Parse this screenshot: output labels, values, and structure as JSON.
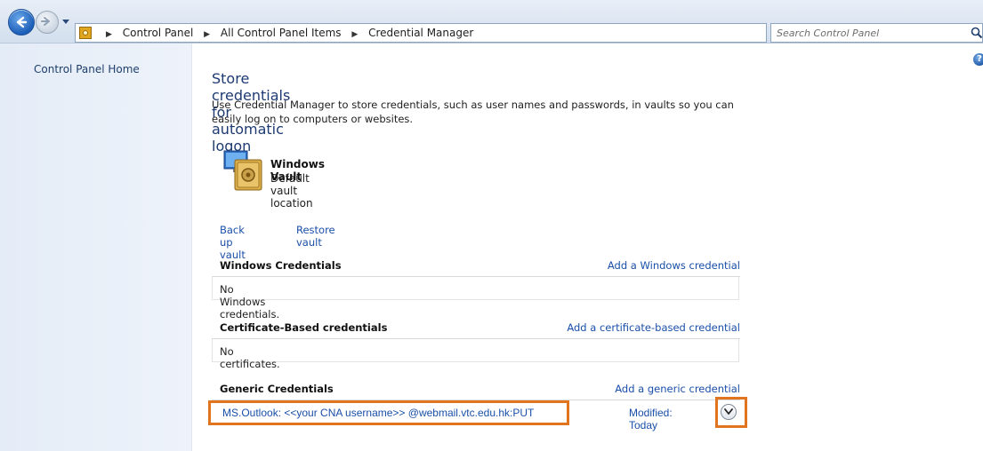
{
  "address_bar": {
    "breadcrumbs": [
      "Control Panel",
      "All Control Panel Items",
      "Credential Manager"
    ],
    "search_placeholder": "Search Control Panel"
  },
  "left_pane": {
    "home_link": "Control Panel Home"
  },
  "main": {
    "title": "Store credentials for automatic logon",
    "description": "Use Credential Manager to store credentials, such as user names and passwords, in vaults so you can easily log on to computers or websites.",
    "vault": {
      "name": "Windows Vault",
      "subtitle": "Default vault location"
    },
    "backup_link": "Back up vault",
    "restore_link": "Restore vault",
    "sections": {
      "windows": {
        "title": "Windows Credentials",
        "add_link": "Add a Windows credential",
        "empty_text": "No Windows credentials."
      },
      "certificate": {
        "title": "Certificate-Based credentials",
        "add_link": "Add a certificate-based credential",
        "empty_text": "No certificates."
      },
      "generic": {
        "title": "Generic Credentials",
        "add_link": "Add a generic credential",
        "item": {
          "name": "MS.Outlook:  <<your CNA username>> @webmail.vtc.edu.hk:PUT",
          "modified": "Modified:  Today"
        }
      }
    }
  },
  "colors": {
    "link": "#1a4fa8",
    "title": "#1e3a72",
    "highlight": "#e1741e"
  }
}
